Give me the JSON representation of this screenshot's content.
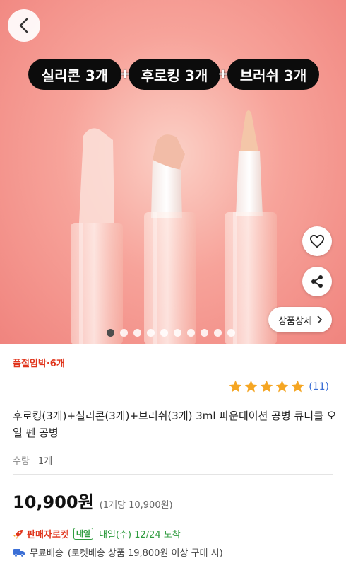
{
  "hero": {
    "pills": [
      "실리콘 3개",
      "후로킹 3개",
      "브러쉬 3개"
    ],
    "plus_sign": "+",
    "detail_button": "상품상세",
    "slide_count": 10,
    "active_slide": 1
  },
  "product": {
    "stock_badge": "품절임박·6개",
    "rating_value": 5,
    "review_count": "(11)",
    "title": "후로킹(3개)+실리콘(3개)+브러쉬(3개) 3ml 파운데이션 공병 큐티클 오일 펜 공병",
    "quantity_label": "수량",
    "quantity_value": "1개",
    "price": "10,900원",
    "unit_price": "(1개당 10,900원)"
  },
  "delivery": {
    "rocket_label": "판매자로켓",
    "tomorrow_badge": "내일",
    "arrival": "내일(수) 12/24 도착",
    "shipping_label": "무료배송",
    "shipping_note": "(로켓배송 상품 19,800원 이상 구매 시)"
  },
  "colors": {
    "accent_red": "#e0341b",
    "rating_star": "#f5a623",
    "link_blue": "#3b6fd6",
    "rocket_green": "#2e9b3e",
    "hero_bg": "#f7a39a"
  },
  "icons": [
    "chevron-left-icon",
    "heart-icon",
    "share-icon",
    "chevron-right-icon",
    "star-icon",
    "rocket-icon",
    "truck-icon"
  ]
}
